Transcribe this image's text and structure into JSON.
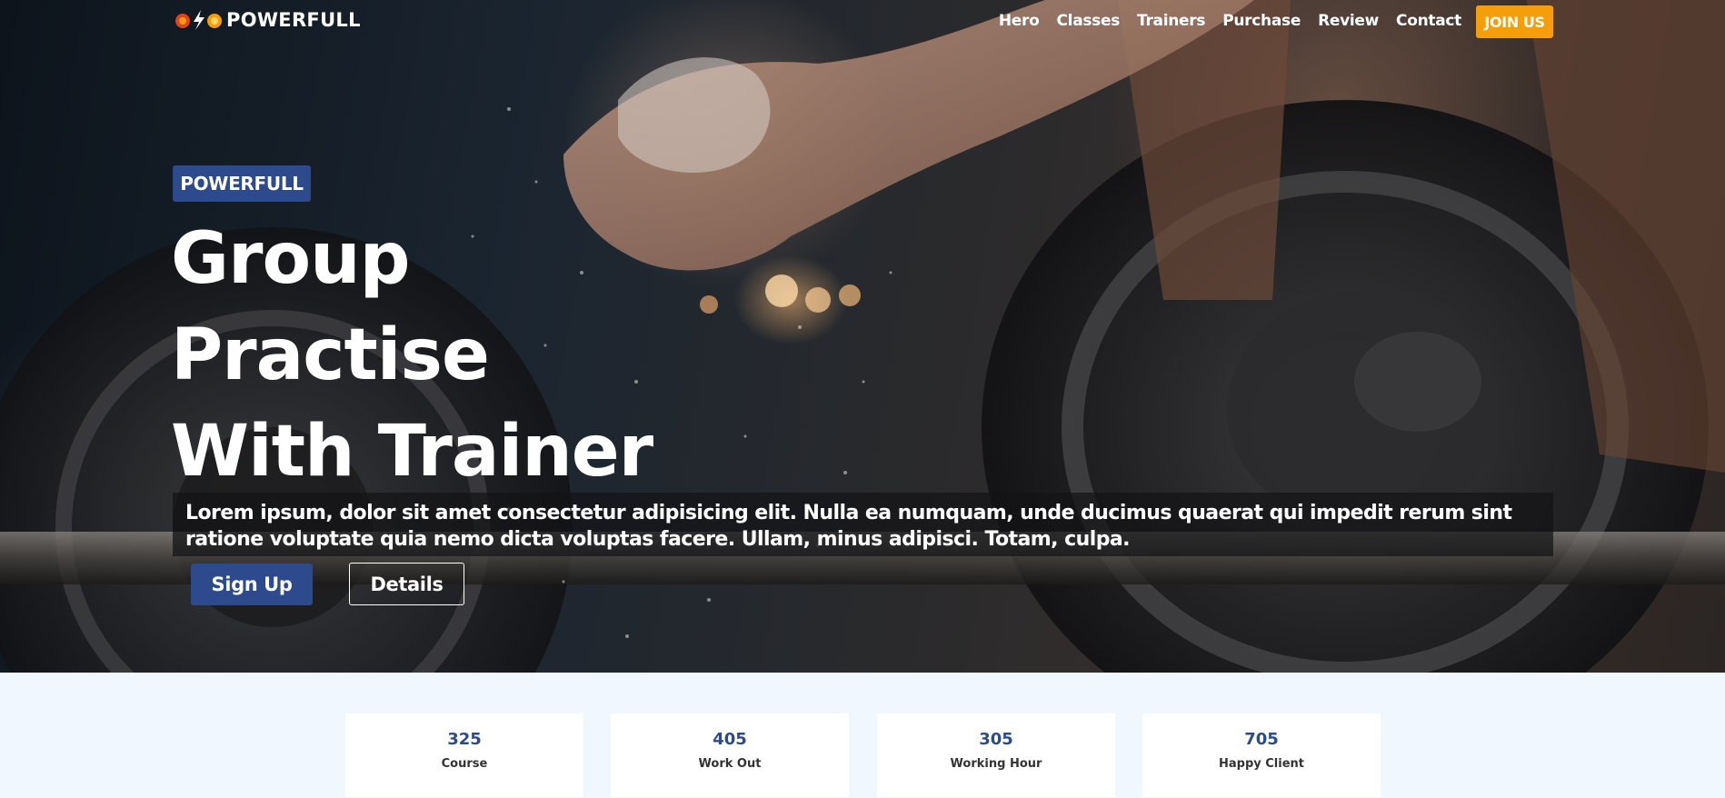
{
  "brand": {
    "name": "POWERFULL",
    "logo_icon": "dumbbell-bolt-icon",
    "accent": "#f59e0b",
    "primary": "#2c4a8c"
  },
  "nav": {
    "items": [
      "Hero",
      "Classes",
      "Trainers",
      "Purchase",
      "Review",
      "Contact"
    ],
    "join_label": "JOIN US"
  },
  "hero": {
    "badge": "POWERFULL",
    "headline": [
      "Group",
      "Practise",
      "With Trainer"
    ],
    "lead": "Lorem ipsum, dolor sit amet consectetur adipisicing elit. Nulla ea numquam, unde ducimus quaerat qui impedit rerum sint ratione voluptate quia nemo dicta voluptas facere. Ullam, minus adipisci. Totam, culpa.",
    "signup_label": "Sign Up",
    "details_label": "Details"
  },
  "stats": [
    {
      "value": "325",
      "label": "Course"
    },
    {
      "value": "405",
      "label": "Work Out"
    },
    {
      "value": "305",
      "label": "Working Hour"
    },
    {
      "value": "705",
      "label": "Happy Client"
    }
  ]
}
